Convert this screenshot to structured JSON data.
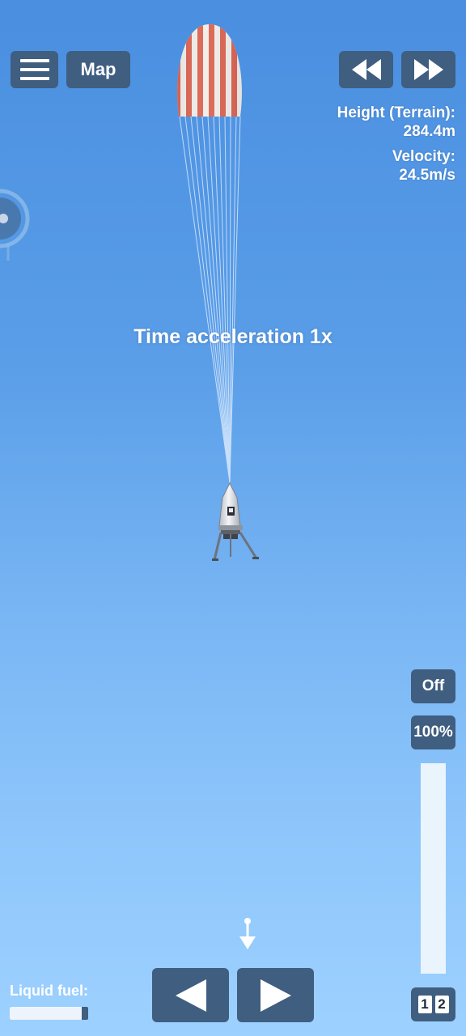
{
  "top_bar": {
    "map_label": "Map"
  },
  "telemetry": {
    "height_label": "Height (Terrain):",
    "height_value": "284.4m",
    "velocity_label": "Velocity:",
    "velocity_value": "24.5m/s"
  },
  "time_acceleration_text": "Time acceleration 1x",
  "throttle": {
    "toggle_label": "Off",
    "percent_label": "100%"
  },
  "stages": {
    "stage_1": "1",
    "stage_2": "2"
  },
  "fuel": {
    "label": "Liquid fuel:",
    "level": 0.92
  },
  "colors": {
    "button_bg": "#3f5e80",
    "parachute_red": "#d9503a",
    "sky_top": "#4a8fe0",
    "sky_bottom": "#9dd1ff"
  }
}
